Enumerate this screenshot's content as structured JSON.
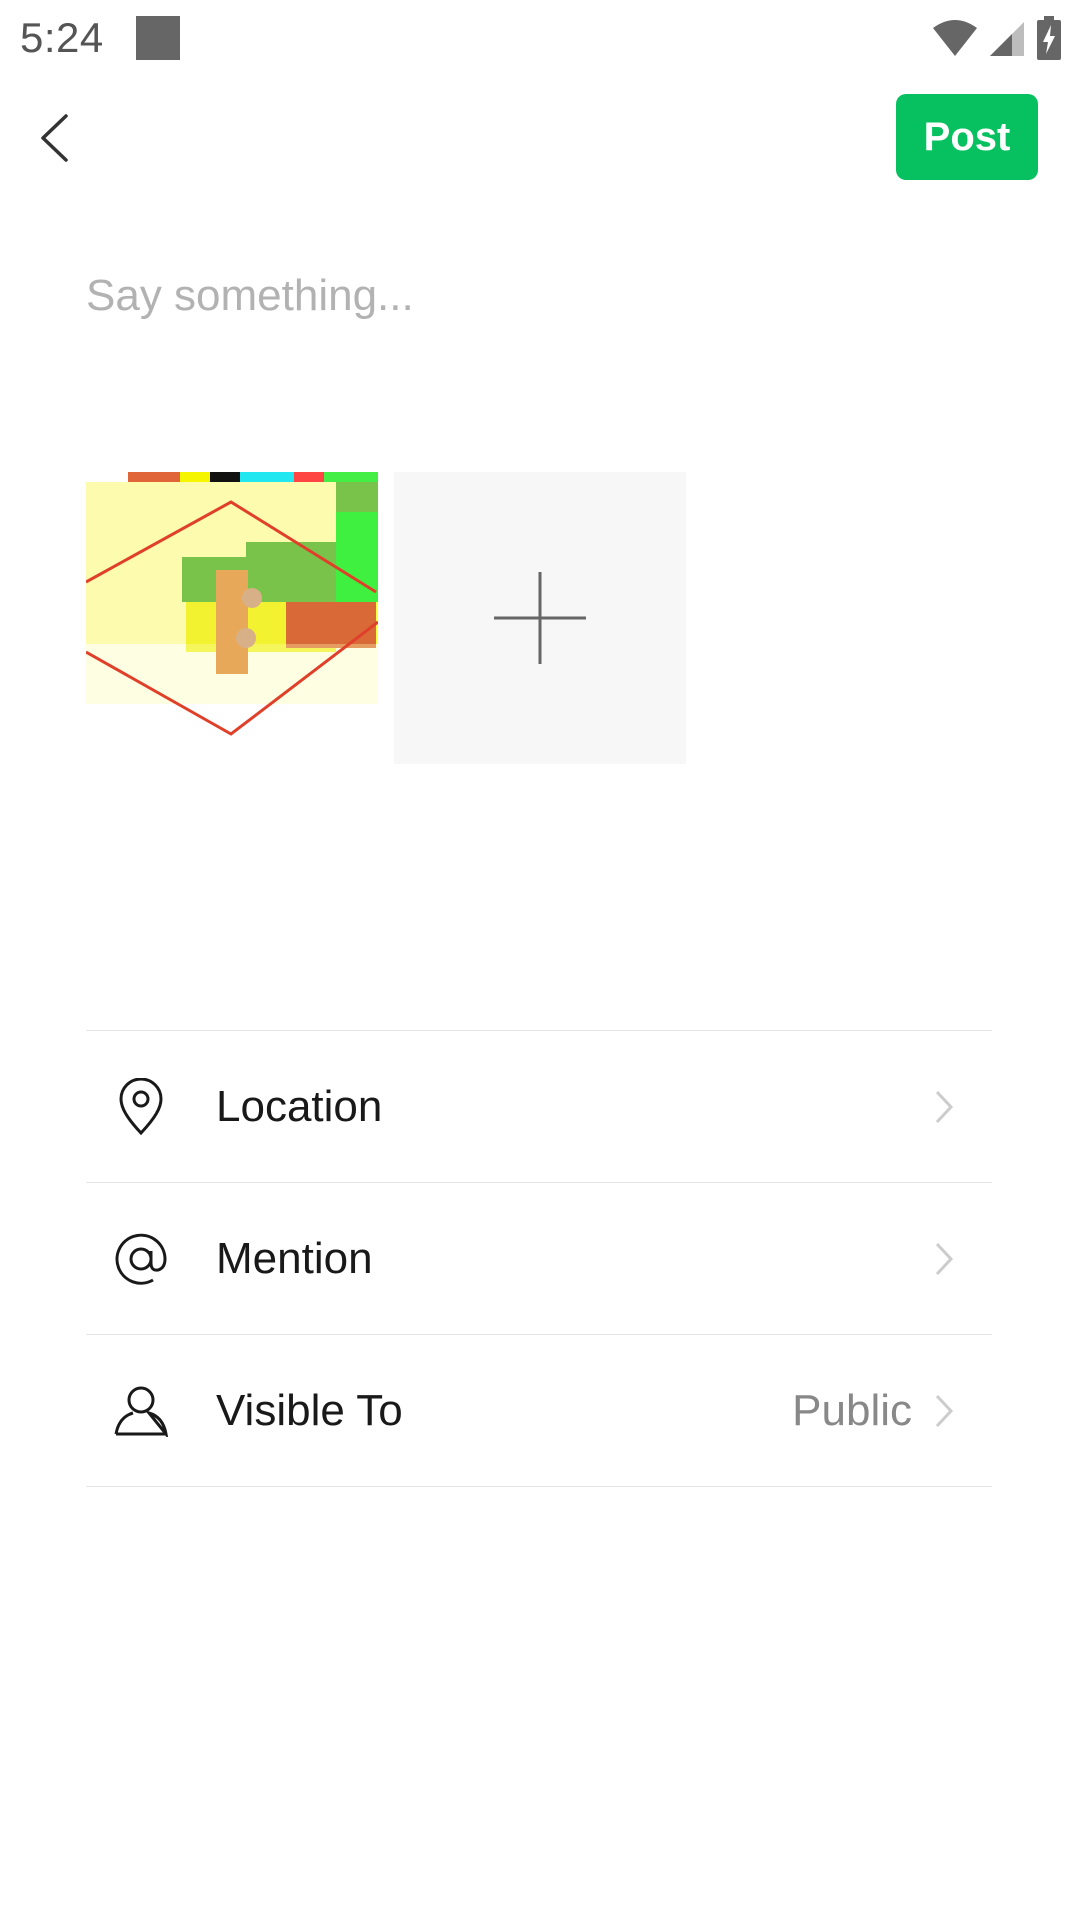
{
  "status_bar": {
    "time": "5:24",
    "icons": [
      "notification-square-icon",
      "wifi-icon",
      "cell-signal-icon",
      "battery-charging-icon"
    ]
  },
  "app_bar": {
    "back_icon": "chevron-left-icon",
    "post_label": "Post",
    "accent_color": "#07c160"
  },
  "composer": {
    "placeholder": "Say something...",
    "value": ""
  },
  "photos": {
    "add_icon": "plus-icon"
  },
  "options": [
    {
      "icon": "location-pin-icon",
      "label": "Location",
      "value": ""
    },
    {
      "icon": "at-sign-icon",
      "label": "Mention",
      "value": ""
    },
    {
      "icon": "person-icon",
      "label": "Visible To",
      "value": "Public"
    }
  ]
}
